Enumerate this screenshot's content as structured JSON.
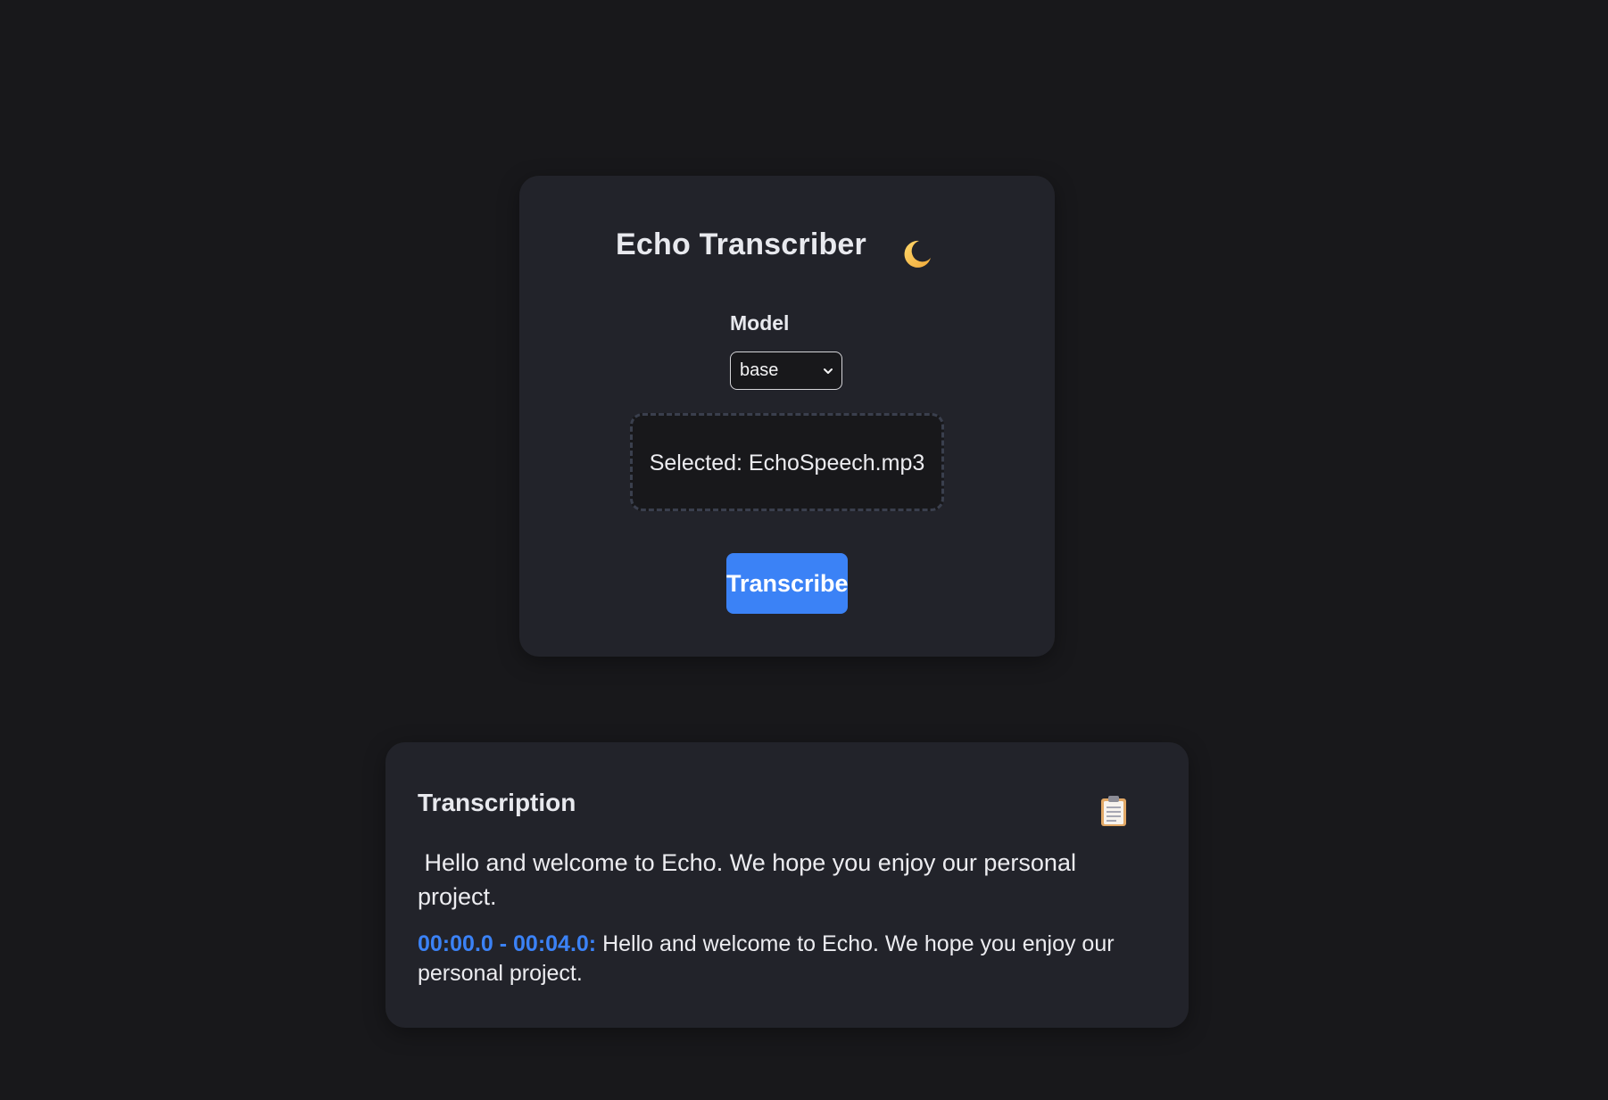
{
  "app": {
    "title": "Echo Transcriber",
    "theme_icon": "crescent-moon-icon"
  },
  "model": {
    "label": "Model",
    "selected": "base"
  },
  "file": {
    "selected_text": "Selected: EchoSpeech.mp3"
  },
  "actions": {
    "transcribe_label": "Transcribe"
  },
  "transcription": {
    "title": "Transcription",
    "copy_icon": "clipboard-icon",
    "full_text": " Hello and welcome to Echo. We hope you enjoy our personal project.",
    "segments": [
      {
        "time": "00:00.0 - 00:04.0:",
        "text": " Hello and welcome to Echo. We hope you enjoy our personal project."
      }
    ]
  },
  "colors": {
    "background": "#18181b",
    "card": "#22232a",
    "accent": "#3b82f6",
    "text": "#ececf0"
  }
}
